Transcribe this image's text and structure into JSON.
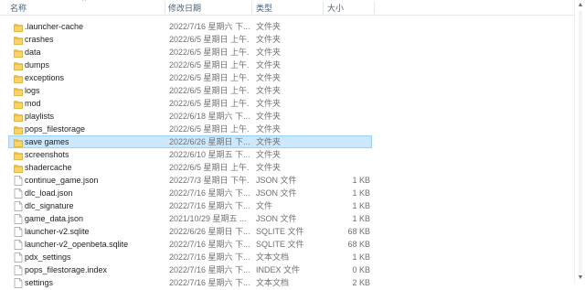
{
  "header": {
    "name_label": "名称",
    "date_label": "修改日期",
    "type_label": "类型",
    "size_label": "大小",
    "sort_indicator": "^"
  },
  "colors": {
    "selection_background": "#cce8ff",
    "selection_border": "#99d1ff",
    "folder_icon": "#f5c542",
    "file_icon_outline": "#9a9a9a"
  },
  "files": [
    {
      "name": ".launcher-cache",
      "date": "2022/7/16 星期六 下...",
      "type": "文件夹",
      "size": "",
      "kind": "folder"
    },
    {
      "name": "crashes",
      "date": "2022/6/5 星期日 上午...",
      "type": "文件夹",
      "size": "",
      "kind": "folder"
    },
    {
      "name": "data",
      "date": "2022/6/5 星期日 上午...",
      "type": "文件夹",
      "size": "",
      "kind": "folder"
    },
    {
      "name": "dumps",
      "date": "2022/6/5 星期日 上午...",
      "type": "文件夹",
      "size": "",
      "kind": "folder"
    },
    {
      "name": "exceptions",
      "date": "2022/6/5 星期日 上午...",
      "type": "文件夹",
      "size": "",
      "kind": "folder"
    },
    {
      "name": "logs",
      "date": "2022/6/5 星期日 上午...",
      "type": "文件夹",
      "size": "",
      "kind": "folder"
    },
    {
      "name": "mod",
      "date": "2022/6/5 星期日 上午...",
      "type": "文件夹",
      "size": "",
      "kind": "folder"
    },
    {
      "name": "playlists",
      "date": "2022/6/18 星期六 下...",
      "type": "文件夹",
      "size": "",
      "kind": "folder"
    },
    {
      "name": "pops_filestorage",
      "date": "2022/6/5 星期日 上午...",
      "type": "文件夹",
      "size": "",
      "kind": "folder"
    },
    {
      "name": "save games",
      "date": "2022/6/26 星期日 下...",
      "type": "文件夹",
      "size": "",
      "kind": "folder",
      "selected": true
    },
    {
      "name": "screenshots",
      "date": "2022/6/10 星期五 下...",
      "type": "文件夹",
      "size": "",
      "kind": "folder"
    },
    {
      "name": "shadercache",
      "date": "2022/6/5 星期日 上午...",
      "type": "文件夹",
      "size": "",
      "kind": "folder"
    },
    {
      "name": "continue_game.json",
      "date": "2022/7/3 星期日 下午...",
      "type": "JSON 文件",
      "size": "1 KB",
      "kind": "file"
    },
    {
      "name": "dlc_load.json",
      "date": "2022/7/16 星期六 下...",
      "type": "JSON 文件",
      "size": "1 KB",
      "kind": "file"
    },
    {
      "name": "dlc_signature",
      "date": "2022/7/16 星期六 下...",
      "type": "文件",
      "size": "1 KB",
      "kind": "file"
    },
    {
      "name": "game_data.json",
      "date": "2021/10/29 星期五 ...",
      "type": "JSON 文件",
      "size": "1 KB",
      "kind": "file"
    },
    {
      "name": "launcher-v2.sqlite",
      "date": "2022/6/26 星期日 下...",
      "type": "SQLITE 文件",
      "size": "68 KB",
      "kind": "file"
    },
    {
      "name": "launcher-v2_openbeta.sqlite",
      "date": "2022/7/16 星期六 下...",
      "type": "SQLITE 文件",
      "size": "68 KB",
      "kind": "file"
    },
    {
      "name": "pdx_settings",
      "date": "2022/7/16 星期六 下...",
      "type": "文本文档",
      "size": "1 KB",
      "kind": "file"
    },
    {
      "name": "pops_filestorage.index",
      "date": "2022/7/16 星期六 下...",
      "type": "INDEX 文件",
      "size": "0 KB",
      "kind": "file"
    },
    {
      "name": "settings",
      "date": "2022/7/16 星期六 下...",
      "type": "文本文档",
      "size": "2 KB",
      "kind": "file"
    }
  ]
}
